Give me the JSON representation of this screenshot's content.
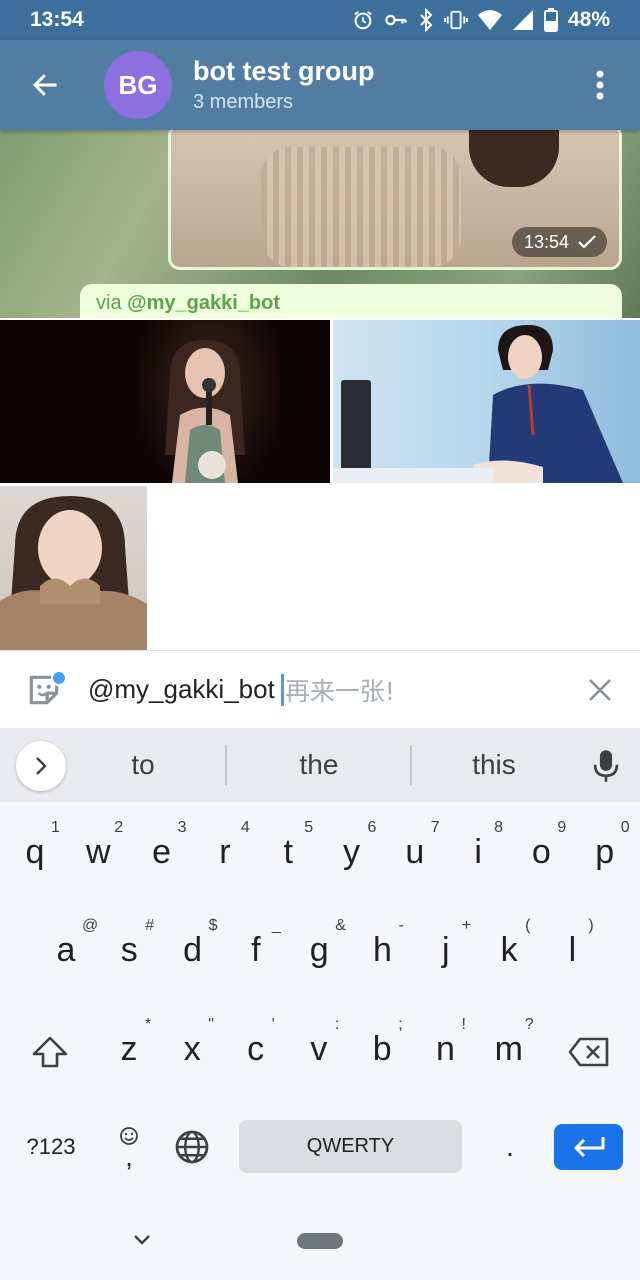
{
  "status_bar": {
    "time": "13:54",
    "battery_percent": "48%",
    "icons": [
      "alarm-icon",
      "vpn-key-icon",
      "bluetooth-icon",
      "vibrate-icon",
      "wifi-icon",
      "cell-signal-icon",
      "battery-icon"
    ]
  },
  "header": {
    "avatar_initials": "BG",
    "avatar_color": "#8e6fe0",
    "title": "bot test group",
    "subtitle": "3 members",
    "bar_color": "#527da3"
  },
  "messages": {
    "photo_time": "13:54",
    "via_prefix": "via ",
    "via_bot": "@my_gakki_bot"
  },
  "composer": {
    "bot_mention": "@my_gakki_bot",
    "placeholder": "再来一张!"
  },
  "suggestions": {
    "words": [
      "to",
      "the",
      "this"
    ]
  },
  "keyboard": {
    "row1": [
      {
        "key": "q",
        "hint": "1"
      },
      {
        "key": "w",
        "hint": "2"
      },
      {
        "key": "e",
        "hint": "3"
      },
      {
        "key": "r",
        "hint": "4"
      },
      {
        "key": "t",
        "hint": "5"
      },
      {
        "key": "y",
        "hint": "6"
      },
      {
        "key": "u",
        "hint": "7"
      },
      {
        "key": "i",
        "hint": "8"
      },
      {
        "key": "o",
        "hint": "9"
      },
      {
        "key": "p",
        "hint": "0"
      }
    ],
    "row2": [
      {
        "key": "a",
        "hint": "@"
      },
      {
        "key": "s",
        "hint": "#"
      },
      {
        "key": "d",
        "hint": "$"
      },
      {
        "key": "f",
        "hint": "_"
      },
      {
        "key": "g",
        "hint": "&"
      },
      {
        "key": "h",
        "hint": "-"
      },
      {
        "key": "j",
        "hint": "+"
      },
      {
        "key": "k",
        "hint": "("
      },
      {
        "key": "l",
        "hint": ")"
      }
    ],
    "row3": [
      {
        "key": "z",
        "hint": "*"
      },
      {
        "key": "x",
        "hint": "\""
      },
      {
        "key": "c",
        "hint": "'"
      },
      {
        "key": "v",
        "hint": ":"
      },
      {
        "key": "b",
        "hint": ";"
      },
      {
        "key": "n",
        "hint": "!"
      },
      {
        "key": "m",
        "hint": "?"
      }
    ],
    "symbols_label": "?123",
    "comma_label": ",",
    "space_label": "QWERTY",
    "period_label": ".",
    "enter_color": "#1a73e8"
  }
}
